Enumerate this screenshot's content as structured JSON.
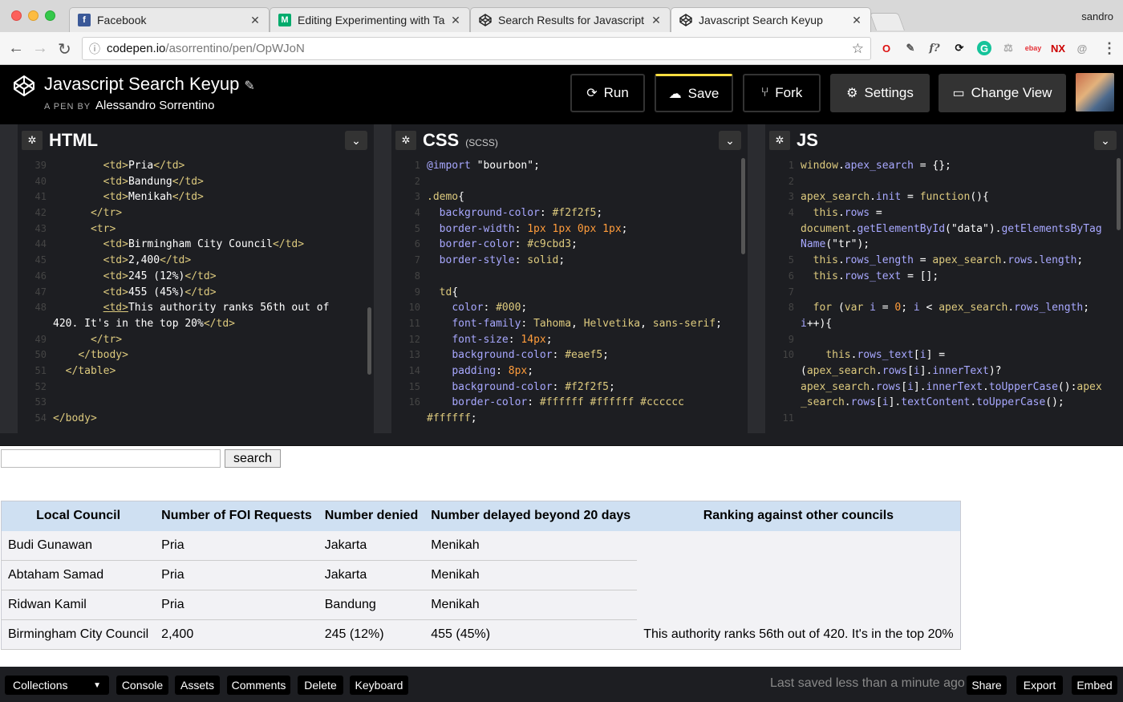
{
  "browser": {
    "profile": "sandro",
    "tabs": [
      {
        "title": "Facebook",
        "icon": "facebook-icon"
      },
      {
        "title": "Editing Experimenting with Tab",
        "icon": "medium-icon"
      },
      {
        "title": "Search Results for Javascript s",
        "icon": "codepen-icon"
      },
      {
        "title": "Javascript Search Keyup",
        "icon": "codepen-icon",
        "active": true
      }
    ],
    "url_host": "codepen.io",
    "url_path": "/asorrentino/pen/OpWJoN"
  },
  "header": {
    "pen_title": "Javascript Search Keyup",
    "pen_by_label": "A PEN BY",
    "author": "Alessandro Sorrentino",
    "buttons": {
      "run": "Run",
      "save": "Save",
      "fork": "Fork",
      "settings": "Settings",
      "change_view": "Change View"
    },
    "save_accent": "#ffdd40"
  },
  "editors": {
    "html": {
      "label": "HTML",
      "lines": [
        {
          "n": "39",
          "html": "        <span class=\"tag\">&lt;td&gt;</span>Pria<span class=\"tag\">&lt;/td&gt;</span>"
        },
        {
          "n": "40",
          "html": "        <span class=\"tag\">&lt;td&gt;</span>Bandung<span class=\"tag\">&lt;/td&gt;</span>"
        },
        {
          "n": "41",
          "html": "        <span class=\"tag\">&lt;td&gt;</span>Menikah<span class=\"tag\">&lt;/td&gt;</span>"
        },
        {
          "n": "42",
          "html": "      <span class=\"tag\">&lt;/tr&gt;</span>"
        },
        {
          "n": "43",
          "html": "      <span class=\"tag\">&lt;tr&gt;</span>"
        },
        {
          "n": "44",
          "html": "        <span class=\"tag\">&lt;td&gt;</span>Birmingham City Council<span class=\"tag\">&lt;/td&gt;</span>"
        },
        {
          "n": "45",
          "html": "        <span class=\"tag\">&lt;td&gt;</span>2,400<span class=\"tag\">&lt;/td&gt;</span>"
        },
        {
          "n": "46",
          "html": "        <span class=\"tag\">&lt;td&gt;</span>245 (12%)<span class=\"tag\">&lt;/td&gt;</span>"
        },
        {
          "n": "47",
          "html": "        <span class=\"tag\">&lt;td&gt;</span>455 (45%)<span class=\"tag\">&lt;/td&gt;</span>"
        },
        {
          "n": "48",
          "html": "        <span class=\"tag\" style=\"text-decoration:underline\">&lt;td&gt;</span>This authority ranks 56th out of"
        },
        {
          "n": "",
          "html": "420. It's in the top 20%<span class=\"tag\">&lt;/td&gt;</span>"
        },
        {
          "n": "49",
          "html": "      <span class=\"tag\">&lt;/tr&gt;</span>"
        },
        {
          "n": "50",
          "html": "    <span class=\"tag\">&lt;/tbody&gt;</span>"
        },
        {
          "n": "51",
          "html": "  <span class=\"tag\">&lt;/table&gt;</span>"
        },
        {
          "n": "52",
          "html": ""
        },
        {
          "n": "53",
          "html": ""
        },
        {
          "n": "54",
          "html": "<span class=\"tag\">&lt;/body&gt;</span>"
        }
      ]
    },
    "css": {
      "label": "CSS",
      "sublabel": "(SCSS)",
      "lines": [
        {
          "n": "1",
          "html": "<span class=\"prop\">@import</span> \"bourbon\";"
        },
        {
          "n": "2",
          "html": ""
        },
        {
          "n": "3",
          "html": "<span class=\"sel\">.demo</span>{"
        },
        {
          "n": "4",
          "html": "  <span class=\"prop\">background-color</span>: <span class=\"kw\">#f2f2f5</span>;"
        },
        {
          "n": "5",
          "html": "  <span class=\"prop\">border-width</span>: <span class=\"num\">1px</span> <span class=\"num\">1px</span> <span class=\"num\">0px</span> <span class=\"num\">1px</span>;"
        },
        {
          "n": "6",
          "html": "  <span class=\"prop\">border-color</span>: <span class=\"kw\">#c9cbd3</span>;"
        },
        {
          "n": "7",
          "html": "  <span class=\"prop\">border-style</span>: <span class=\"kw\">solid</span>;"
        },
        {
          "n": "8",
          "html": ""
        },
        {
          "n": "9",
          "html": "  <span class=\"sel\">td</span>{"
        },
        {
          "n": "10",
          "html": "    <span class=\"prop\">color</span>: <span class=\"kw\">#000</span>;"
        },
        {
          "n": "11",
          "html": "    <span class=\"prop\">font-family</span>: <span class=\"kw\">Tahoma</span>, <span class=\"kw\">Helvetika</span>, <span class=\"kw\">sans-serif</span>;"
        },
        {
          "n": "12",
          "html": "    <span class=\"prop\">font-size</span>: <span class=\"num\">14px</span>;"
        },
        {
          "n": "13",
          "html": "    <span class=\"prop\">background-color</span>: <span class=\"kw\">#eaef5</span>;"
        },
        {
          "n": "14",
          "html": "    <span class=\"prop\">padding</span>: <span class=\"num\">8px</span>;"
        },
        {
          "n": "15",
          "html": "    <span class=\"prop\">background-color</span>: <span class=\"kw\">#f2f2f5</span>;"
        },
        {
          "n": "16",
          "html": "    <span class=\"prop\">border-color</span>: <span class=\"kw\">#ffffff</span> <span class=\"kw\">#ffffff</span> <span class=\"kw\">#cccccc</span>"
        },
        {
          "n": "",
          "html": "<span class=\"kw\">#ffffff</span>;"
        }
      ]
    },
    "js": {
      "label": "JS",
      "lines": [
        {
          "n": "1",
          "html": "<span class=\"fn\">window</span>.<span class=\"prop\">apex_search</span> = {};"
        },
        {
          "n": "2",
          "html": ""
        },
        {
          "n": "3",
          "html": "<span class=\"fn\">apex_search</span>.<span class=\"prop\">init</span> = <span class=\"fn\">function</span>(){"
        },
        {
          "n": "4",
          "html": "  <span class=\"fn\">this</span>.<span class=\"prop\">rows</span> ="
        },
        {
          "n": "",
          "html": "<span class=\"fn\">document</span>.<span class=\"prop\">getElementById</span>(\"data\").<span class=\"prop\">getElementsByTag</span>"
        },
        {
          "n": "",
          "html": "<span class=\"prop\">Name</span>(\"tr\");"
        },
        {
          "n": "5",
          "html": "  <span class=\"fn\">this</span>.<span class=\"prop\">rows_length</span> = <span class=\"fn\">apex_search</span>.<span class=\"prop\">rows</span>.<span class=\"prop\">length</span>;"
        },
        {
          "n": "6",
          "html": "  <span class=\"fn\">this</span>.<span class=\"prop\">rows_text</span> = [];"
        },
        {
          "n": "7",
          "html": ""
        },
        {
          "n": "8",
          "html": "  <span class=\"fn\">for</span> (<span class=\"fn\">var</span> <span class=\"prop\">i</span> = <span class=\"num\">0</span>; <span class=\"prop\">i</span> &lt; <span class=\"fn\">apex_search</span>.<span class=\"prop\">rows_length</span>;"
        },
        {
          "n": "",
          "html": "<span class=\"prop\">i</span>++){"
        },
        {
          "n": "9",
          "html": ""
        },
        {
          "n": "10",
          "html": "    <span class=\"fn\">this</span>.<span class=\"prop\">rows_text</span>[<span class=\"prop\">i</span>] ="
        },
        {
          "n": "",
          "html": "(<span class=\"fn\">apex_search</span>.<span class=\"prop\">rows</span>[<span class=\"prop\">i</span>].<span class=\"prop\">innerText</span>)?"
        },
        {
          "n": "",
          "html": "<span class=\"fn\">apex_search</span>.<span class=\"prop\">rows</span>[<span class=\"prop\">i</span>].<span class=\"prop\">innerText</span>.<span class=\"prop\">toUpperCase</span>():<span class=\"fn\">apex</span>"
        },
        {
          "n": "",
          "html": "<span class=\"fn\">_search</span>.<span class=\"prop\">rows</span>[<span class=\"prop\">i</span>].<span class=\"prop\">textContent</span>.<span class=\"prop\">toUpperCase</span>();"
        },
        {
          "n": "11",
          "html": ""
        }
      ]
    }
  },
  "result": {
    "search_button": "search",
    "search_value": "",
    "columns": [
      "Local Council",
      "Number of FOI Requests",
      "Number denied",
      "Number delayed beyond 20 days",
      "Ranking against other councils"
    ],
    "rows": [
      [
        "Budi Gunawan",
        "Pria",
        "Jakarta",
        "Menikah",
        ""
      ],
      [
        "Abtaham Samad",
        "Pria",
        "Jakarta",
        "Menikah",
        ""
      ],
      [
        "Ridwan Kamil",
        "Pria",
        "Bandung",
        "Menikah",
        ""
      ],
      [
        "Birmingham City Council",
        "2,400",
        "245 (12%)",
        "455 (45%)",
        "This authority ranks 56th out of 420. It's in the top 20%"
      ]
    ]
  },
  "footer": {
    "collections": "Collections",
    "console": "Console",
    "assets": "Assets",
    "comments": "Comments",
    "delete": "Delete",
    "keyboard": "Keyboard",
    "saved_msg": "Last saved less than a minute ago",
    "share": "Share",
    "export": "Export",
    "embed": "Embed"
  }
}
